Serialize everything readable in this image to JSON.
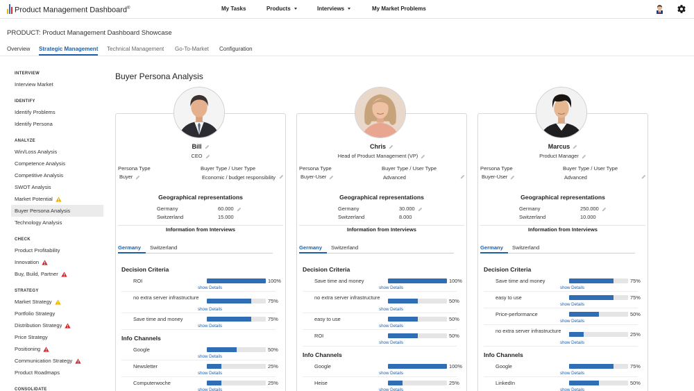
{
  "app": {
    "title": "Product Management Dashboard",
    "trademark": "®"
  },
  "topnav": {
    "my_tasks": "My Tasks",
    "products": "Products",
    "interviews": "Interviews",
    "my_market_problems": "My Market Problems"
  },
  "product": {
    "title": "PRODUCT: Product Management Dashboard Showcase",
    "tabs": [
      "Overview",
      "Strategic Management",
      "Technical Management",
      "Go-To-Market",
      "Configuration"
    ],
    "active_tab": "Strategic Management"
  },
  "sidebar": {
    "sections": [
      {
        "heading": "INTERVIEW",
        "items": [
          {
            "label": "Interview Market"
          }
        ]
      },
      {
        "heading": "IDENTIFY",
        "items": [
          {
            "label": "Identify Problems"
          },
          {
            "label": "Identify Persona"
          }
        ]
      },
      {
        "heading": "ANALYZE",
        "items": [
          {
            "label": "Win/Loss Analysis"
          },
          {
            "label": "Competence Analysis"
          },
          {
            "label": "Competitive Analysis"
          },
          {
            "label": "SWOT Analysis"
          },
          {
            "label": "Market Potential",
            "status": "warning"
          },
          {
            "label": "Buyer Persona Analysis",
            "active": true
          },
          {
            "label": "Technology Analysis"
          }
        ]
      },
      {
        "heading": "CHECK",
        "items": [
          {
            "label": "Product Profitability"
          },
          {
            "label": "Innovation",
            "status": "alert"
          },
          {
            "label": "Buy, Build, Partner",
            "status": "alert"
          }
        ]
      },
      {
        "heading": "STRATEGY",
        "items": [
          {
            "label": "Market Strategy",
            "status": "warning"
          },
          {
            "label": "Portfolio Strategy"
          },
          {
            "label": "Distribution Strategy",
            "status": "alert"
          },
          {
            "label": "Price Strategy"
          },
          {
            "label": "Positioning",
            "status": "alert"
          },
          {
            "label": "Communication Strategy",
            "status": "alert"
          },
          {
            "label": "Product Roadmaps"
          }
        ]
      },
      {
        "heading": "CONSOLIDATE",
        "items": []
      }
    ]
  },
  "main": {
    "title": "Buyer Persona Analysis",
    "labels": {
      "persona_type": "Persona Type",
      "buyer_type": "Buyer Type / User Type",
      "geo": "Geographical representations",
      "info": "Information from Interviews",
      "decision": "Decision Criteria",
      "channels": "Info Channels",
      "show_details": "show Details"
    },
    "personas": [
      {
        "name": "Bill",
        "role": "CEO",
        "persona_type": "Buyer",
        "buyer_type": "Economic / budget responsibility",
        "geo": [
          {
            "country": "Germany",
            "value": "60.000"
          },
          {
            "country": "Switzerland",
            "value": "15.000"
          }
        ],
        "tabs": [
          "Germany",
          "Switzerland"
        ],
        "decision_criteria": [
          {
            "label": "ROI",
            "pct": 100,
            "pct_label": "100%"
          },
          {
            "label": "no extra server infrastructure",
            "pct": 75,
            "pct_label": "75%"
          },
          {
            "label": "Save time and money",
            "pct": 75,
            "pct_label": "75%"
          }
        ],
        "info_channels": [
          {
            "label": "Google",
            "pct": 50,
            "pct_label": "50%"
          },
          {
            "label": "Newsletter",
            "pct": 25,
            "pct_label": "25%"
          },
          {
            "label": "Computerwoche",
            "pct": 25,
            "pct_label": "25%"
          }
        ]
      },
      {
        "name": "Chris",
        "role": "Head of Product Management (VP)",
        "persona_type": "Buyer-User",
        "buyer_type": "Advanced",
        "geo": [
          {
            "country": "Germany",
            "value": "30.000"
          },
          {
            "country": "Switzerland",
            "value": "8.000"
          }
        ],
        "tabs": [
          "Germany",
          "Switzerland"
        ],
        "decision_criteria": [
          {
            "label": "Save time and money",
            "pct": 100,
            "pct_label": "100%"
          },
          {
            "label": "no extra server infrastructure",
            "pct": 50,
            "pct_label": "50%"
          },
          {
            "label": "easy to use",
            "pct": 50,
            "pct_label": "50%"
          },
          {
            "label": "ROI",
            "pct": 50,
            "pct_label": "50%"
          }
        ],
        "info_channels": [
          {
            "label": "Google",
            "pct": 100,
            "pct_label": "100%"
          },
          {
            "label": "Heise",
            "pct": 25,
            "pct_label": "25%"
          }
        ]
      },
      {
        "name": "Marcus",
        "role": "Product Manager",
        "persona_type": "Buyer-User",
        "buyer_type": "Advanced",
        "geo": [
          {
            "country": "Germany",
            "value": "250.000"
          },
          {
            "country": "Switzerland",
            "value": "10.000"
          }
        ],
        "tabs": [
          "Germany",
          "Switzerland"
        ],
        "decision_criteria": [
          {
            "label": "Save time and money",
            "pct": 75,
            "pct_label": "75%"
          },
          {
            "label": "easy to use",
            "pct": 75,
            "pct_label": "75%"
          },
          {
            "label": "Price-performance",
            "pct": 50,
            "pct_label": "50%"
          },
          {
            "label": "no extra server infrastructure",
            "pct": 25,
            "pct_label": "25%"
          }
        ],
        "info_channels": [
          {
            "label": "Google",
            "pct": 75,
            "pct_label": "75%"
          },
          {
            "label": "LinkedIn",
            "pct": 50,
            "pct_label": "50%"
          }
        ]
      }
    ]
  },
  "colors": {
    "accent": "#1f5fa8",
    "bar_fill": "#2f6db4",
    "bar_track": "#e5e5e5",
    "warning": "#f0b400",
    "alert": "#d9262a",
    "active_sidebar_bg": "#ebebeb"
  },
  "icons": {
    "logo": "bar-chart-logo-icon",
    "avatar": "user-avatar-icon",
    "settings": "gear-icon",
    "edit": "pencil-icon",
    "warning": "warning-triangle-icon",
    "alert": "alert-triangle-icon"
  }
}
